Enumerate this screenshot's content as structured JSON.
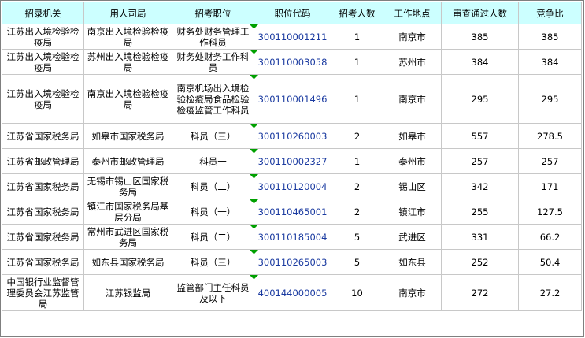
{
  "headers": [
    "招录机关",
    "用人司局",
    "招考职位",
    "职位代码",
    "招考人数",
    "工作地点",
    "审查通过人数",
    "竞争比"
  ],
  "rows": [
    [
      "江苏出入境检验检疫局",
      "南京出入境检验检疫局",
      "财务处财务管理工作科员",
      "300110001211",
      "1",
      "南京市",
      "385",
      "385"
    ],
    [
      "江苏出入境检验检疫局",
      "苏州出入境检验检疫局",
      "财务处财务工作科员",
      "300110003058",
      "1",
      "苏州市",
      "384",
      "384"
    ],
    [
      "江苏出入境检验检疫局",
      "南京出入境检验检疫局",
      "南京机场出入境检验检疫局食品检验检疫监管工作科员",
      "300110001496",
      "1",
      "南京市",
      "295",
      "295"
    ],
    [
      "江苏省国家税务局",
      "如皋市国家税务局",
      "科员（三）",
      "300110260003",
      "2",
      "如皋市",
      "557",
      "278.5"
    ],
    [
      "江苏省邮政管理局",
      "泰州市邮政管理局",
      "科员一",
      "300110002327",
      "1",
      "泰州市",
      "257",
      "257"
    ],
    [
      "江苏省国家税务局",
      "无锡市锡山区国家税务局",
      "科员（二）",
      "300110120004",
      "2",
      "锡山区",
      "342",
      "171"
    ],
    [
      "江苏省国家税务局",
      "镇江市国家税务局基层分局",
      "科员（一）",
      "300110465001",
      "2",
      "镇江市",
      "255",
      "127.5"
    ],
    [
      "江苏省国家税务局",
      "常州市武进区国家税务局",
      "科员（二）",
      "300110185004",
      "5",
      "武进区",
      "331",
      "66.2"
    ],
    [
      "江苏省国家税务局",
      "如东县国家税务局",
      "科员（三）",
      "300110265003",
      "5",
      "如东县",
      "252",
      "50.4"
    ],
    [
      "中国银行业监督管理委员会江苏监管局",
      "江苏银监局",
      "监管部门主任科员及以下",
      "400144000005",
      "10",
      "南京市",
      "272",
      "27.2"
    ]
  ]
}
